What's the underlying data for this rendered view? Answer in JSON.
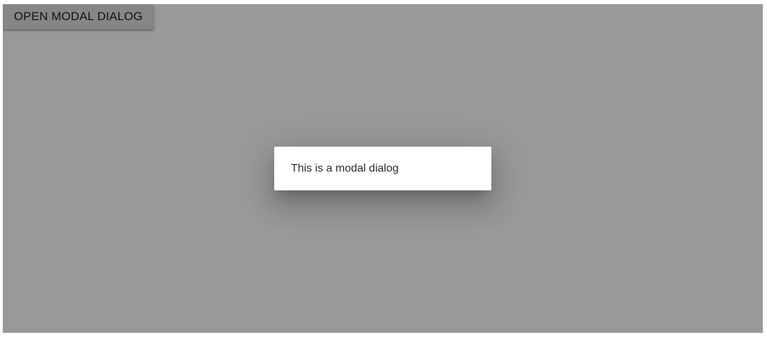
{
  "toolbar": {
    "open_button_label": "OPEN MODAL DIALOG"
  },
  "dialog": {
    "message": "This is a modal dialog"
  },
  "colors": {
    "backdrop": "#9c9c9c",
    "dialog_background": "#ffffff",
    "button_background": "#e0e0e0"
  }
}
